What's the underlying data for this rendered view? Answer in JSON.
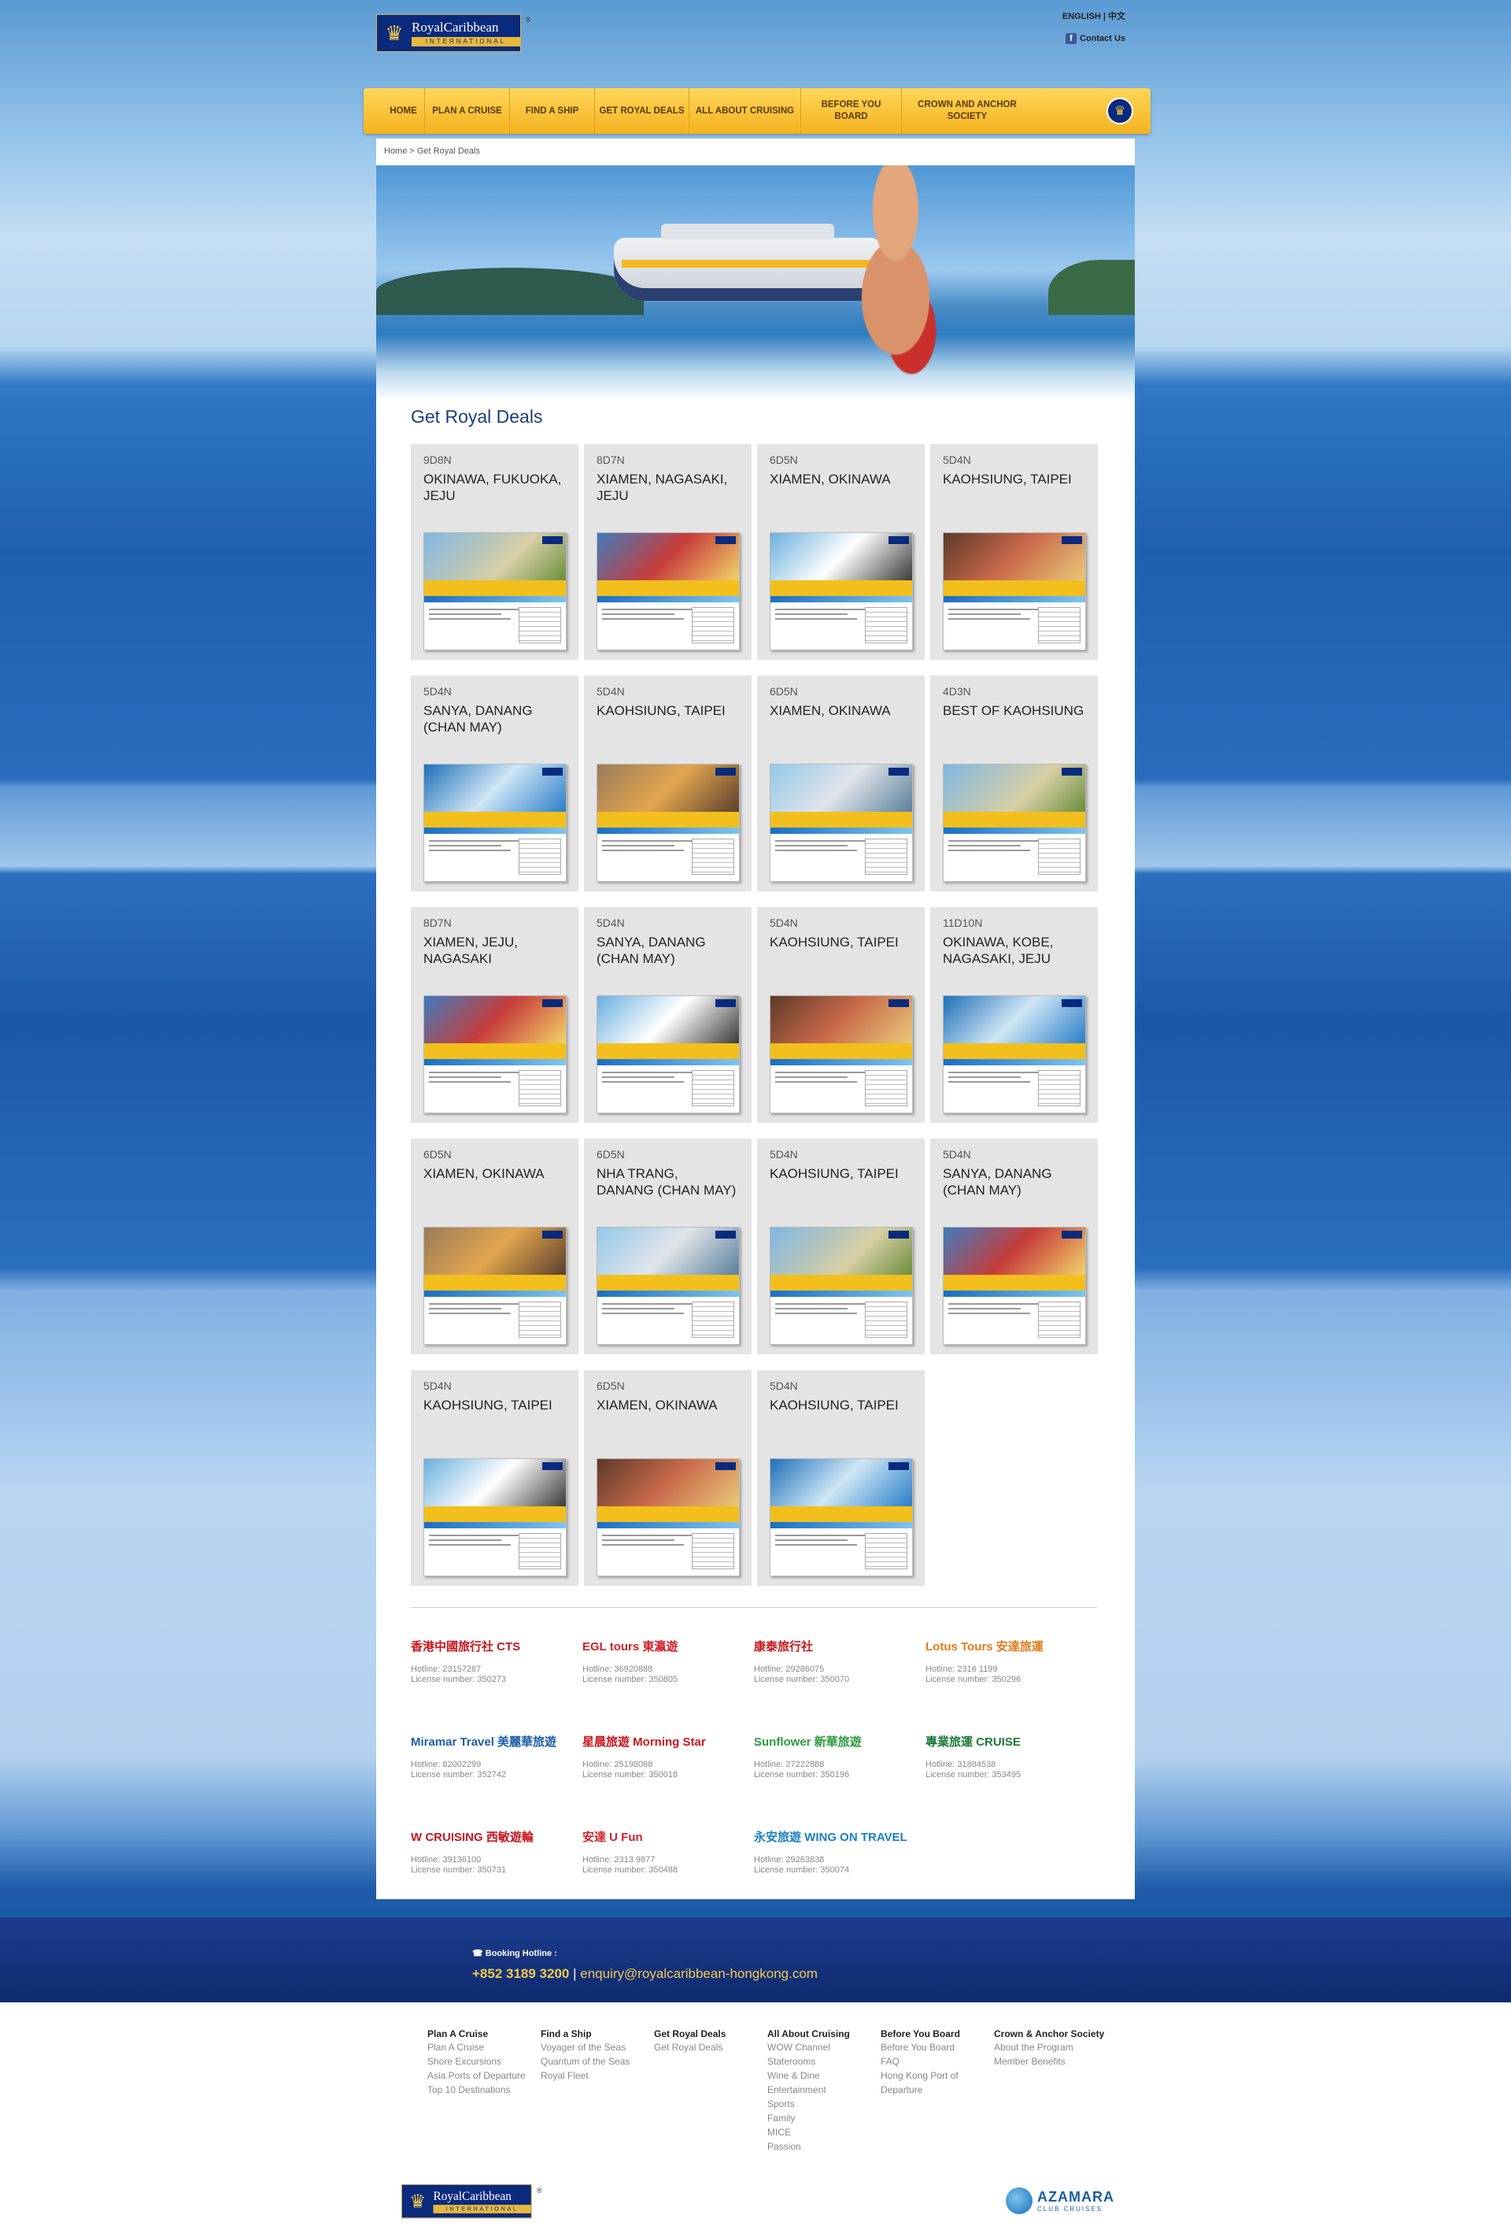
{
  "header": {
    "brand": "RoyalCaribbean",
    "brand_sub": "INTERNATIONAL",
    "reg": "®",
    "lang": "ENGLISH | 中文",
    "contact": "Contact Us"
  },
  "nav": [
    "HOME",
    "PLAN A CRUISE",
    "FIND A SHIP",
    "GET ROYAL DEALS",
    "ALL ABOUT CRUISING",
    "BEFORE YOU BOARD",
    "CROWN AND ANCHOR SOCIETY"
  ],
  "breadcrumb": "Home > Get Royal Deals",
  "page_title": "Get Royal Deals",
  "deals": [
    {
      "dur": "9D8N",
      "dest": "OKINAWA, FUKUOKA, JEJU"
    },
    {
      "dur": "8D7N",
      "dest": "XIAMEN, NAGASAKI, JEJU"
    },
    {
      "dur": "6D5N",
      "dest": "XIAMEN, OKINAWA"
    },
    {
      "dur": "5D4N",
      "dest": "KAOHSIUNG, TAIPEI"
    },
    {
      "dur": "5D4N",
      "dest": "SANYA, DANANG (CHAN MAY)"
    },
    {
      "dur": "5D4N",
      "dest": "KAOHSIUNG, TAIPEI"
    },
    {
      "dur": "6D5N",
      "dest": "XIAMEN, OKINAWA"
    },
    {
      "dur": "4D3N",
      "dest": "BEST OF KAOHSIUNG"
    },
    {
      "dur": "8D7N",
      "dest": "XIAMEN, JEJU, NAGASAKI"
    },
    {
      "dur": "5D4N",
      "dest": "SANYA, DANANG (CHAN MAY)"
    },
    {
      "dur": "5D4N",
      "dest": "KAOHSIUNG, TAIPEI"
    },
    {
      "dur": "11D10N",
      "dest": "OKINAWA, KOBE, NAGASAKI, JEJU"
    },
    {
      "dur": "6D5N",
      "dest": "XIAMEN, OKINAWA"
    },
    {
      "dur": "6D5N",
      "dest": "NHA TRANG, DANANG (CHAN MAY)"
    },
    {
      "dur": "5D4N",
      "dest": "KAOHSIUNG, TAIPEI"
    },
    {
      "dur": "5D4N",
      "dest": "SANYA, DANANG (CHAN MAY)"
    },
    {
      "dur": "5D4N",
      "dest": "KAOHSIUNG, TAIPEI"
    },
    {
      "dur": "6D5N",
      "dest": "XIAMEN, OKINAWA"
    },
    {
      "dur": "5D4N",
      "dest": "KAOHSIUNG, TAIPEI"
    }
  ],
  "agents": [
    {
      "logo": "香港中國旅行社 CTS",
      "color": "#c8161d",
      "hotline": "Hotline: 23157287",
      "license": "License number: 350273"
    },
    {
      "logo": "EGL tours 東瀛遊",
      "color": "#d4202a",
      "hotline": "Hotline: 36920888",
      "license": "License number: 350805"
    },
    {
      "logo": "康泰旅行社",
      "color": "#c8161d",
      "hotline": "Hotline: 29286075",
      "license": "License number: 350070"
    },
    {
      "logo": "Lotus Tours 安達旅運",
      "color": "#e27b1a",
      "hotline": "Hotline: 2316 1199",
      "license": "License number: 350296"
    },
    {
      "logo": "Miramar Travel 美麗華旅遊",
      "color": "#1e5fa8",
      "hotline": "Hotline: 82002299",
      "license": "License number: 352742"
    },
    {
      "logo": "星晨旅遊 Morning Star",
      "color": "#c8161d",
      "hotline": "Hotline: 25198088",
      "license": "License number: 350018"
    },
    {
      "logo": "Sunflower 新華旅遊",
      "color": "#2e9a3c",
      "hotline": "Hotline: 27222888",
      "license": "License number: 350196"
    },
    {
      "logo": "專業旅運 CRUISE",
      "color": "#1d7a3a",
      "hotline": "Hotline: 31884538",
      "license": "License number: 353495"
    },
    {
      "logo": "W CRUISING 西敏遊輪",
      "color": "#c8161d",
      "hotline": "Hotline: 39136100",
      "license": "License number: 350731"
    },
    {
      "logo": "安達 U Fun",
      "color": "#d4202a",
      "hotline": "Hotline: 2313 9877",
      "license": "License number: 350488"
    },
    {
      "logo": "永安旅遊 WING ON TRAVEL",
      "color": "#1a7fc4",
      "hotline": "Hotline: 29263838",
      "license": "License number: 350074"
    }
  ],
  "footer": {
    "booking_label": "☎ Booking Hotline :",
    "phone": "+852 3189 3200",
    "sep": " | ",
    "email": "enquiry@royalcaribbean-hongkong.com",
    "columns": [
      {
        "title": "Plan A Cruise",
        "links": [
          "Plan A Cruise",
          "Shore Excursions",
          "Asia Ports of Departure",
          "Top 10 Destinations"
        ]
      },
      {
        "title": "Find a Ship",
        "links": [
          "Voyager of the Seas",
          "Quantum of the Seas",
          "Royal Fleet"
        ]
      },
      {
        "title": "Get Royal Deals",
        "links": [
          "Get Royal Deals"
        ]
      },
      {
        "title": "All About Cruising",
        "links": [
          "WOW Channel",
          "Staterooms",
          "Wine & Dine",
          "Entertainment",
          "Sports",
          "Family",
          "MICE",
          "Passion"
        ]
      },
      {
        "title": "Before You Board",
        "links": [
          "Before You Board",
          "FAQ",
          "Hong Kong Port of Departure"
        ]
      },
      {
        "title": "Crown & Anchor Society",
        "links": [
          "About the Program",
          "Member Benefits"
        ]
      }
    ],
    "azamara": "AZAMARA",
    "azamara_sub": "CLUB CRUISES"
  },
  "colors": {
    "nav": "#f3b21f",
    "brand_navy": "#0a2a7e",
    "title": "#1c3f7a",
    "footer_band": "#1c3d8f"
  }
}
